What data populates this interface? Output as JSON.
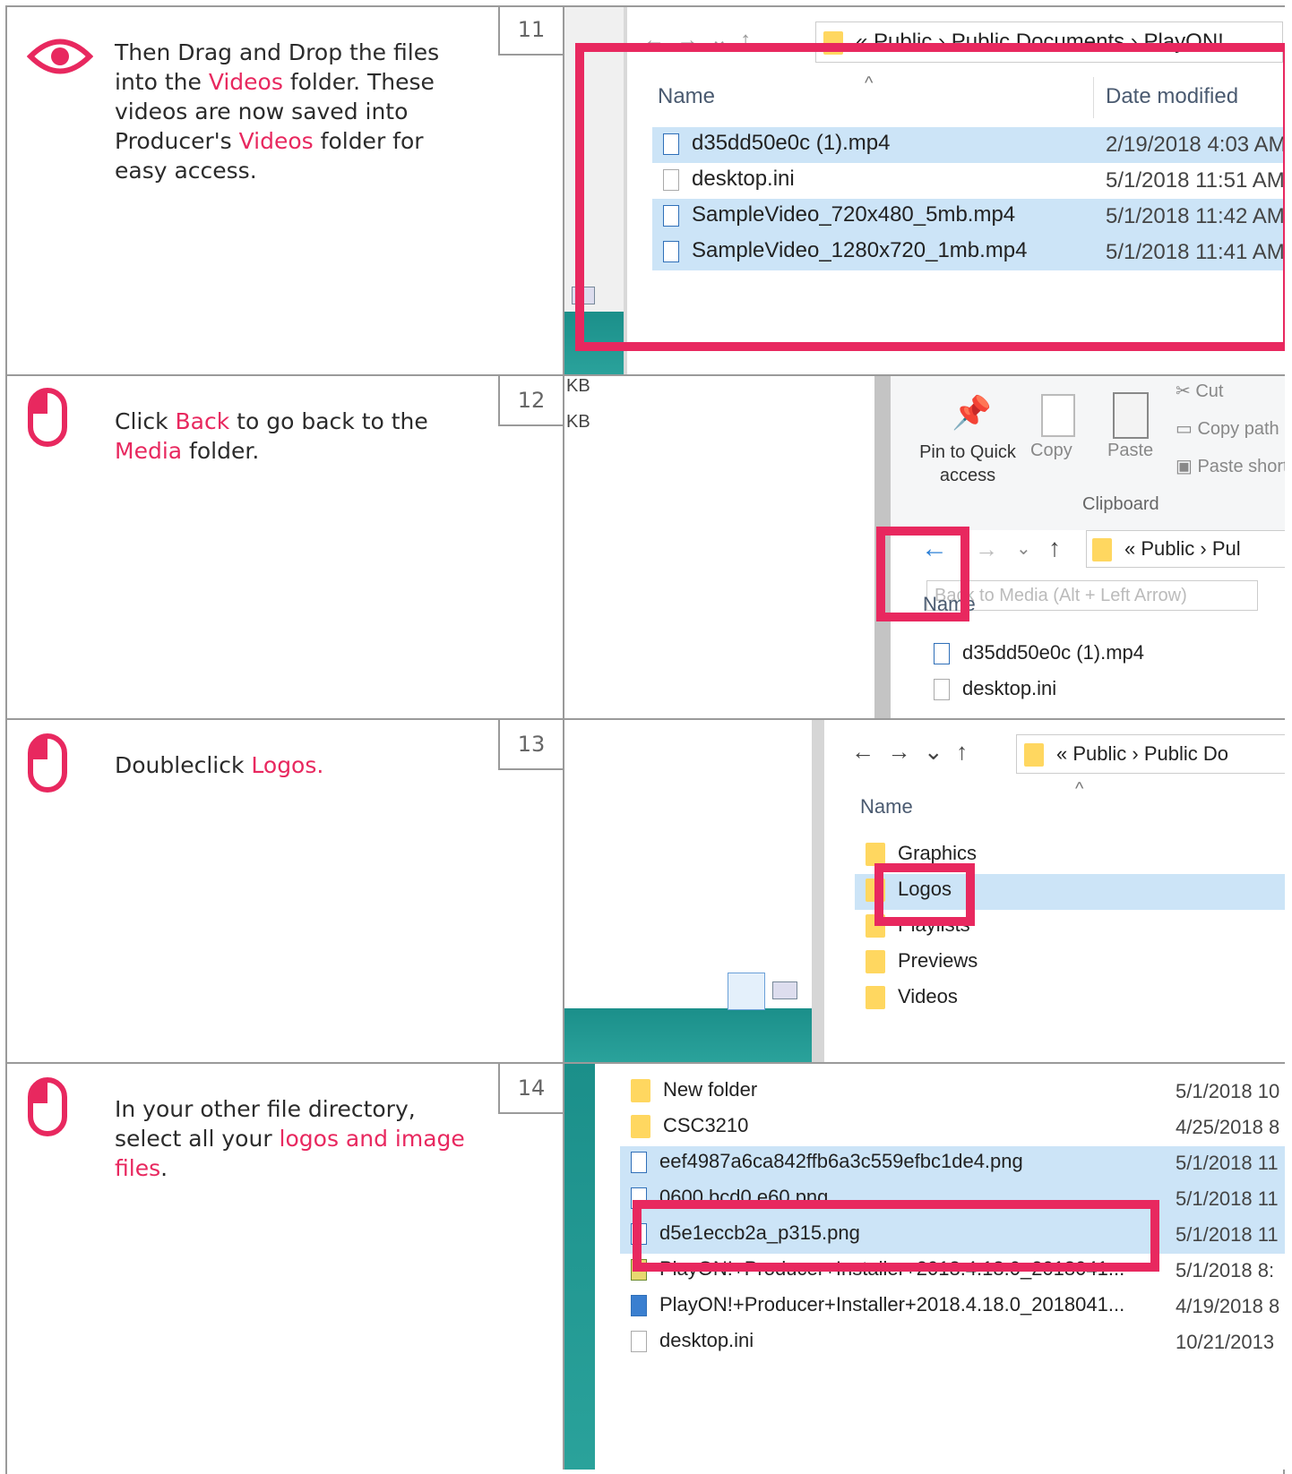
{
  "steps": [
    {
      "number": "11",
      "icon": "eye-icon",
      "text_parts": [
        "Then Drag and Drop the files into the ",
        "Videos",
        " folder. These videos are now saved into Producer's ",
        "Videos",
        " folder for easy access."
      ],
      "screenshot": {
        "breadcrumb": [
          "Public",
          "Public Documents",
          "PlayON!"
        ],
        "columns": [
          "Name",
          "Date modified"
        ],
        "files": [
          {
            "name": "d35dd50e0c (1).mp4",
            "date": "2/19/2018 4:03 AM",
            "selected": true
          },
          {
            "name": "desktop.ini",
            "date": "5/1/2018 11:51 AM",
            "selected": false
          },
          {
            "name": "SampleVideo_720x480_5mb.mp4",
            "date": "5/1/2018 11:42 AM",
            "selected": true
          },
          {
            "name": "SampleVideo_1280x720_1mb.mp4",
            "date": "5/1/2018 11:41 AM",
            "selected": true
          }
        ]
      }
    },
    {
      "number": "12",
      "icon": "mouse-icon",
      "text_parts": [
        "Click ",
        "Back",
        " to go back to the ",
        "Media",
        " folder."
      ],
      "screenshot": {
        "side_labels": [
          "KB",
          "KB"
        ],
        "ribbon": [
          "Pin to Quick access",
          "Copy",
          "Paste",
          "Cut",
          "Copy path",
          "Paste shortcut"
        ],
        "ribbon_group": "Clipboard",
        "breadcrumb": [
          "Public",
          "Pul"
        ],
        "tooltip": "Back to Media (Alt + Left Arrow)",
        "column": "Name",
        "files": [
          "d35dd50e0c (1).mp4",
          "desktop.ini"
        ]
      }
    },
    {
      "number": "13",
      "icon": "mouse-icon",
      "text_parts": [
        "Doubleclick ",
        "Logos."
      ],
      "screenshot": {
        "breadcrumb": [
          "Public",
          "Public Do"
        ],
        "column": "Name",
        "folders": [
          "Graphics",
          "Logos",
          "Playlists",
          "Previews",
          "Videos"
        ]
      }
    },
    {
      "number": "14",
      "icon": "mouse-icon",
      "text_parts": [
        "In your other file directory, select all your ",
        "logos and image files",
        "."
      ],
      "screenshot": {
        "files": [
          {
            "name": "New folder",
            "date": "5/1/2018 10",
            "type": "folder",
            "selected": false
          },
          {
            "name": "CSC3210",
            "date": "4/25/2018 8",
            "type": "folder",
            "selected": false
          },
          {
            "name": "eef4987a6ca842ffb6a3c559efbc1de4.png",
            "date": "5/1/2018 11",
            "type": "image",
            "selected": true
          },
          {
            "name": "0600 bcd0 e60.png",
            "date": "5/1/2018 11",
            "type": "image",
            "selected": true
          },
          {
            "name": "d5e1eccb2a_p315.png",
            "date": "5/1/2018 11",
            "type": "image",
            "selected": true
          },
          {
            "name": "PlayON!+Producer+Installer+2018.4.18.0_2018041...",
            "date": "5/1/2018 8:",
            "type": "archive",
            "selected": false
          },
          {
            "name": "PlayON!+Producer+Installer+2018.4.18.0_2018041...",
            "date": "4/19/2018 8",
            "type": "installer",
            "selected": false
          },
          {
            "name": "desktop.ini",
            "date": "10/21/2013",
            "type": "ini",
            "selected": false
          }
        ]
      }
    }
  ],
  "colors": {
    "accent": "#e8285f",
    "selection": "#cce4f7",
    "border": "#9a9a9a"
  }
}
